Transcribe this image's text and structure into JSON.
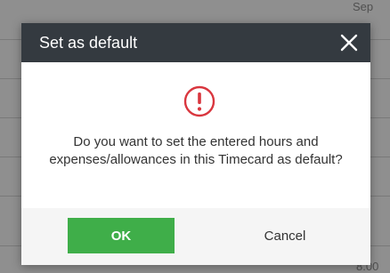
{
  "background": {
    "corner_text_top": "Sep",
    "corner_text_bottom": "8.00"
  },
  "dialog": {
    "title": "Set as default",
    "close_icon": "close-icon",
    "warning_icon": "exclamation-circle-icon",
    "message": "Do you want to set the entered hours and expenses/allowances in this Timecard as default?",
    "ok_label": "OK",
    "cancel_label": "Cancel"
  },
  "colors": {
    "header_bg": "#343a40",
    "ok_button_bg": "#3fae49",
    "warning_red": "#d9363e",
    "footer_bg": "#f5f5f5"
  }
}
